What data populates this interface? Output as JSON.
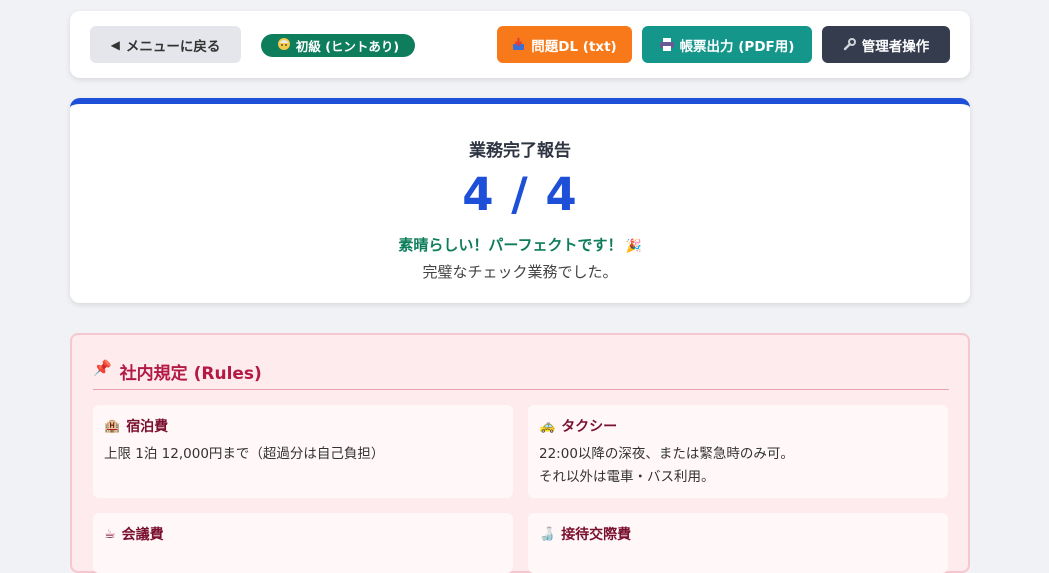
{
  "header": {
    "back_label": "メニューに戻る",
    "level_label": "初級 (ヒントあり)",
    "download_label": "問題DL (txt)",
    "pdf_label": "帳票出力 (PDF用)",
    "admin_label": "管理者操作",
    "icons": {
      "back": "triangle-left-icon",
      "level": "beginner-face-icon",
      "download": "download-icon",
      "pdf": "printer-icon",
      "admin": "wrench-icon"
    }
  },
  "result": {
    "title": "業務完了報告",
    "score": "4 / 4",
    "praise": "素晴らしい！パーフェクトです！",
    "praise_icon": "party-popper-icon",
    "comment": "完璧なチェック業務でした。"
  },
  "rules": {
    "title": "社内規定 (Rules)",
    "title_icon": "pushpin-icon",
    "items": [
      {
        "title": "宿泊費",
        "icon": "hotel-icon",
        "body": "上限 1泊 12,000円まで（超過分は自己負担）"
      },
      {
        "title": "タクシー",
        "icon": "taxi-icon",
        "body": "22:00以降の深夜、または緊急時のみ可。\nそれ以外は電車・バス利用。"
      },
      {
        "title": "会議費",
        "icon": "coffee-icon",
        "body": ""
      },
      {
        "title": "接待交際費",
        "icon": "drink-icon",
        "body": ""
      }
    ]
  },
  "colors": {
    "accent_blue": "#1d4fd8",
    "success_green": "#0e7d5b",
    "orange": "#f77919",
    "teal": "#14968b",
    "dark": "#353c4d",
    "rules_red": "#b31943"
  }
}
